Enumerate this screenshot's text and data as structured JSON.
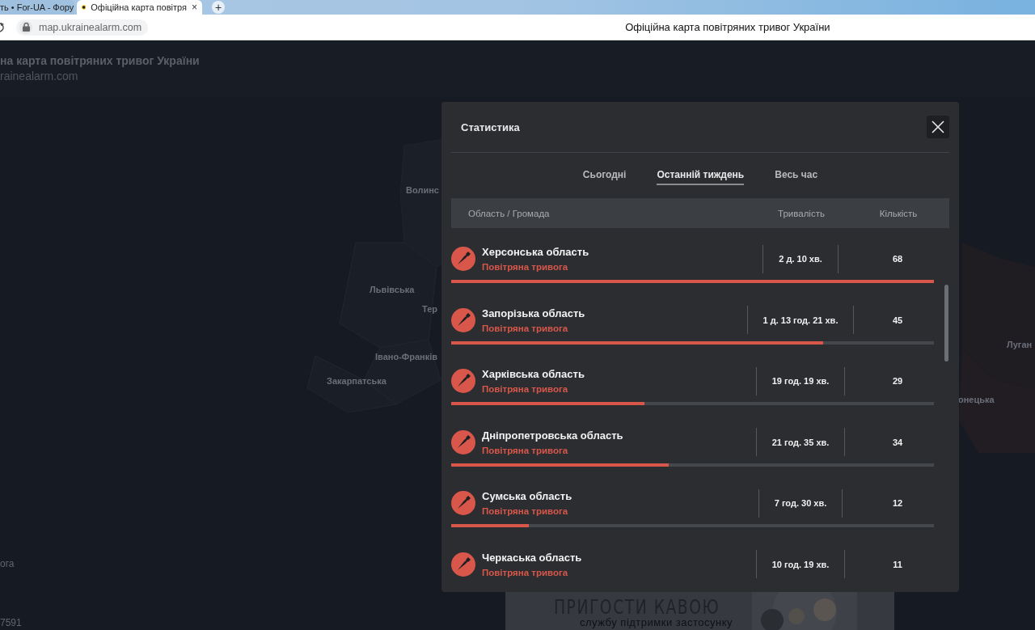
{
  "browser": {
    "tabs": [
      {
        "title": "ть • For-UA - Фору",
        "selected": false
      },
      {
        "title": "Офіційна карта повітря",
        "selected": true
      }
    ],
    "tab_close": "×",
    "new_tab": "+",
    "address": "map.ukrainealarm.com",
    "page_title": "Офіційна карта повітряних тривог України"
  },
  "page_header": {
    "title": "на карта повітряних тривог України",
    "subtitle": "rainealarm.com"
  },
  "map": {
    "labels": [
      "Волинс",
      "Львівська",
      "Тер",
      "Івано-Франків",
      "Закарпатська",
      "онецька",
      "Луган"
    ],
    "side_texts": [
      "ога",
      "7591"
    ]
  },
  "banner": {
    "headline": "ПРИГОСТИ КАВОЮ",
    "subline": "службу підтримки застосунку"
  },
  "modal": {
    "title": "Статистика",
    "tabs": [
      {
        "label": "Сьогодні",
        "selected": false
      },
      {
        "label": "Останній тиждень",
        "selected": true
      },
      {
        "label": "Весь час",
        "selected": false
      }
    ],
    "columns": [
      "Область / Громада",
      "Тривалість",
      "Кількість"
    ],
    "rows": [
      {
        "name": "Херсонська область",
        "status": "Повітряна тривога",
        "duration": "2 д. 10 хв.",
        "count": "68",
        "level": 1.0
      },
      {
        "name": "Запорізька область",
        "status": "Повітряна тривога",
        "duration": "1 д. 13 год. 21 хв.",
        "count": "45",
        "level": 0.77
      },
      {
        "name": "Харківська область",
        "status": "Повітряна тривога",
        "duration": "19 год. 19 хв.",
        "count": "29",
        "level": 0.4
      },
      {
        "name": "Дніпропетровська область",
        "status": "Повітряна тривога",
        "duration": "21 год. 35 хв.",
        "count": "34",
        "level": 0.45
      },
      {
        "name": "Сумська область",
        "status": "Повітряна тривога",
        "duration": "7 год. 30 хв.",
        "count": "12",
        "level": 0.16
      },
      {
        "name": "Черкаська область",
        "status": "Повітряна тривога",
        "duration": "10 год. 19 хв.",
        "count": "11"
      }
    ]
  }
}
